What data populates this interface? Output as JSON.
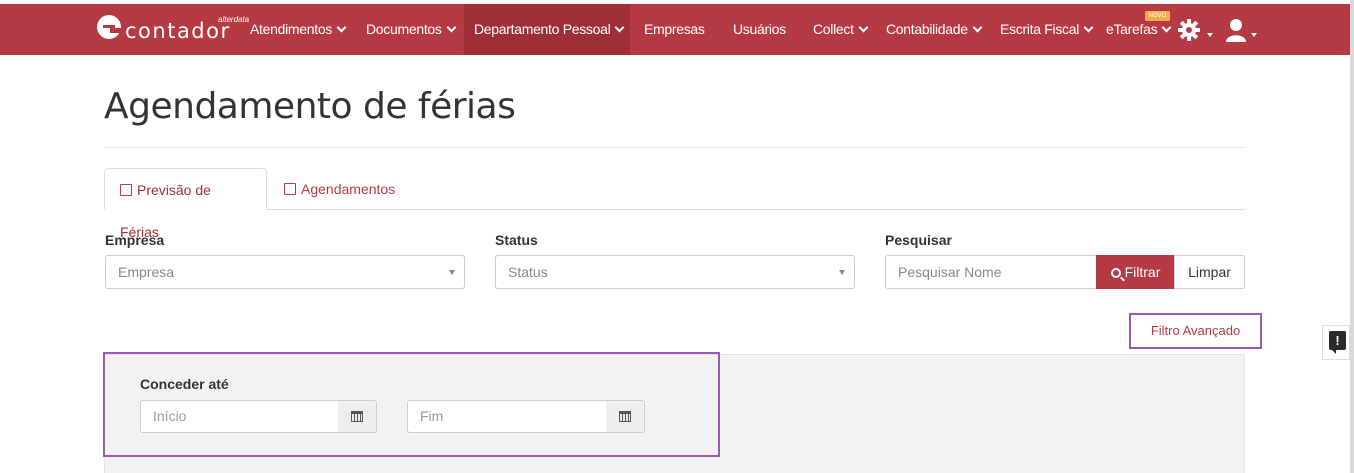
{
  "nav": {
    "brand_word": "contador",
    "brand_sub": "alterdata",
    "items": [
      {
        "label": "Atendimentos",
        "caret": true
      },
      {
        "label": "Documentos",
        "caret": true
      },
      {
        "label": "Departamento Pessoal",
        "caret": true,
        "active": true
      },
      {
        "label": "Empresas",
        "caret": false
      },
      {
        "label": "Usuários",
        "caret": false
      },
      {
        "label": "Collect",
        "caret": true
      },
      {
        "label": "Contabilidade",
        "caret": true
      },
      {
        "label": "Escrita Fiscal",
        "caret": true
      },
      {
        "label": "eTarefas",
        "caret": true
      }
    ],
    "novo_badge": "NOVO",
    "settings_icon": "gear-icon",
    "user_icon": "user-icon",
    "accent_color": "#b63a44"
  },
  "page": {
    "title": "Agendamento de férias"
  },
  "tabs": [
    {
      "label": "Previsão de Férias",
      "icon": "contact-card-icon",
      "active": true
    },
    {
      "label": "Agendamentos",
      "icon": "calendar-check-icon",
      "active": false
    }
  ],
  "filters": {
    "empresa": {
      "label": "Empresa",
      "value": "Empresa"
    },
    "status": {
      "label": "Status",
      "value": "Status"
    },
    "pesquisar": {
      "label": "Pesquisar",
      "placeholder": "Pesquisar Nome"
    },
    "filtrar_label": "Filtrar",
    "limpar_label": "Limpar",
    "advanced_link": "Filtro Avançado"
  },
  "advanced": {
    "conceder_label": "Conceder até",
    "inicio_placeholder": "Início",
    "fim_placeholder": "Fim"
  }
}
